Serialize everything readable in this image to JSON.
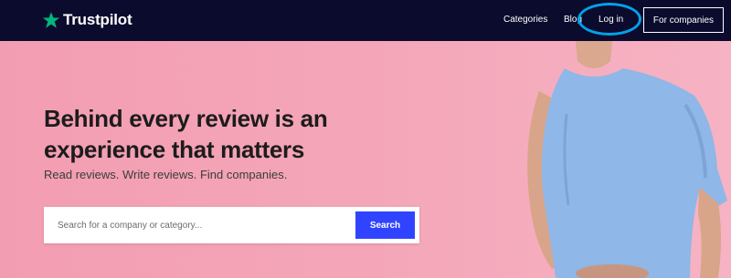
{
  "nav": {
    "logo_text": "Trustpilot",
    "logo_icon": "star-icon",
    "links": {
      "categories": "Categories",
      "blog": "Blog",
      "login": "Log in"
    },
    "for_companies": "For companies"
  },
  "hero": {
    "headline_line1": "Behind every review is an",
    "headline_line2": "experience that matters",
    "subline": "Read reviews. Write reviews. Find companies."
  },
  "search": {
    "placeholder": "Search for a company or category...",
    "button_label": "Search"
  },
  "colors": {
    "nav_bg": "#0b0b2e",
    "brand_green": "#00b67a",
    "hero_bg": "#f4a7b9",
    "search_button": "#3044ff",
    "highlight_ring": "#00a2e8"
  }
}
